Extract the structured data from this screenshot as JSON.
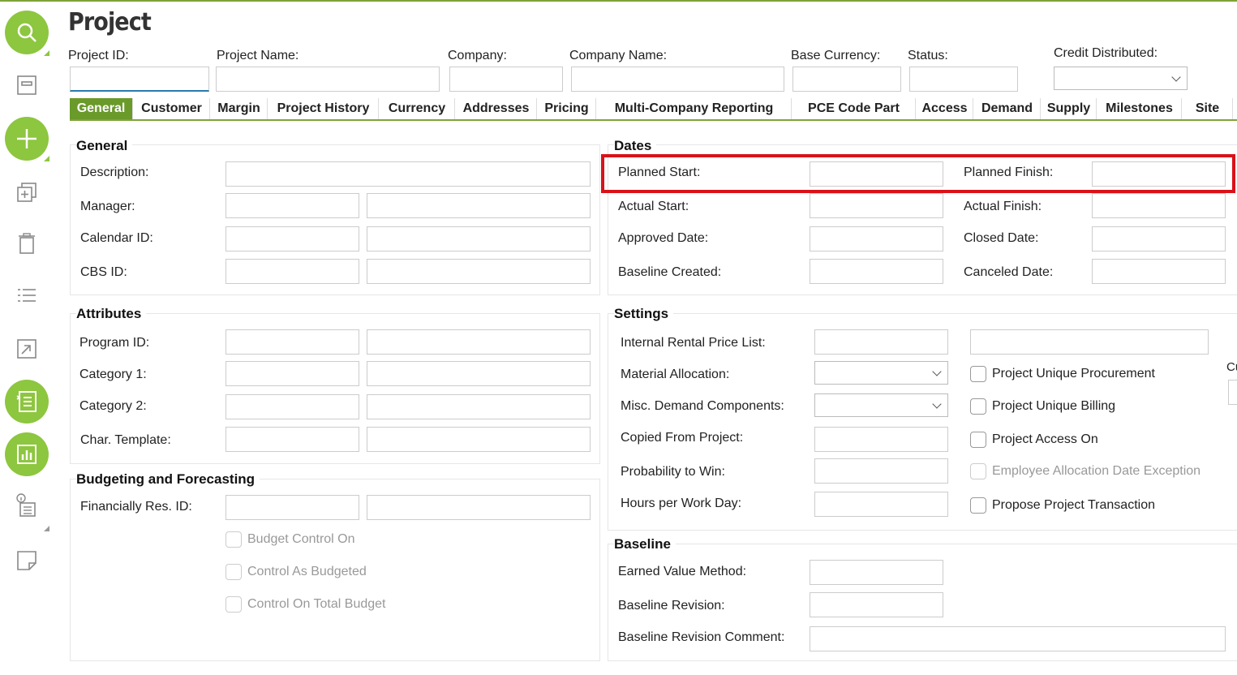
{
  "title": "Project",
  "header": {
    "project_id_label": "Project ID:",
    "project_name_label": "Project Name:",
    "company_label": "Company:",
    "company_name_label": "Company Name:",
    "base_currency_label": "Base Currency:",
    "status_label": "Status:",
    "credit_distributed_label": "Credit Distributed:"
  },
  "tabs": [
    "General",
    "Customer",
    "Margin",
    "Project History",
    "Currency",
    "Addresses",
    "Pricing",
    "Multi-Company Reporting",
    "PCE Code Part",
    "Access",
    "Demand",
    "Supply",
    "Milestones",
    "Site"
  ],
  "general": {
    "title": "General",
    "description": "Description:",
    "manager": "Manager:",
    "calendar_id": "Calendar ID:",
    "cbs_id": "CBS ID:"
  },
  "attributes": {
    "title": "Attributes",
    "program_id": "Program ID:",
    "category1": "Category 1:",
    "category2": "Category 2:",
    "char_template": "Char. Template:"
  },
  "budgeting": {
    "title": "Budgeting and Forecasting",
    "financially_res_id": "Financially Res. ID:",
    "budget_control_on": "Budget Control On",
    "control_as_budgeted": "Control As Budgeted",
    "control_on_total_budget": "Control On Total Budget"
  },
  "dates": {
    "title": "Dates",
    "planned_start": "Planned Start:",
    "planned_finish": "Planned Finish:",
    "actual_start": "Actual Start:",
    "actual_finish": "Actual Finish:",
    "approved_date": "Approved Date:",
    "closed_date": "Closed Date:",
    "baseline_created": "Baseline Created:",
    "canceled_date": "Canceled Date:"
  },
  "settings": {
    "title": "Settings",
    "internal_rental_price_list": "Internal Rental Price List:",
    "material_allocation": "Material Allocation:",
    "misc_demand_components": "Misc. Demand Components:",
    "copied_from_project": "Copied From Project:",
    "probability_to_win": "Probability to Win:",
    "hours_per_work_day": "Hours per Work Day:",
    "project_unique_procurement": "Project Unique Procurement",
    "project_unique_billing": "Project Unique Billing",
    "project_access_on": "Project Access On",
    "employee_allocation_date_exception": "Employee Allocation Date Exception",
    "propose_project_transaction": "Propose Project Transaction",
    "cut_label": "Cu"
  },
  "baseline": {
    "title": "Baseline",
    "earned_value_method": "Earned Value Method:",
    "baseline_revision": "Baseline Revision:",
    "baseline_revision_comment": "Baseline Revision Comment:"
  },
  "colors": {
    "accent": "#8dc63f",
    "tab_active": "#6a9a2a",
    "highlight": "#d9121a"
  }
}
